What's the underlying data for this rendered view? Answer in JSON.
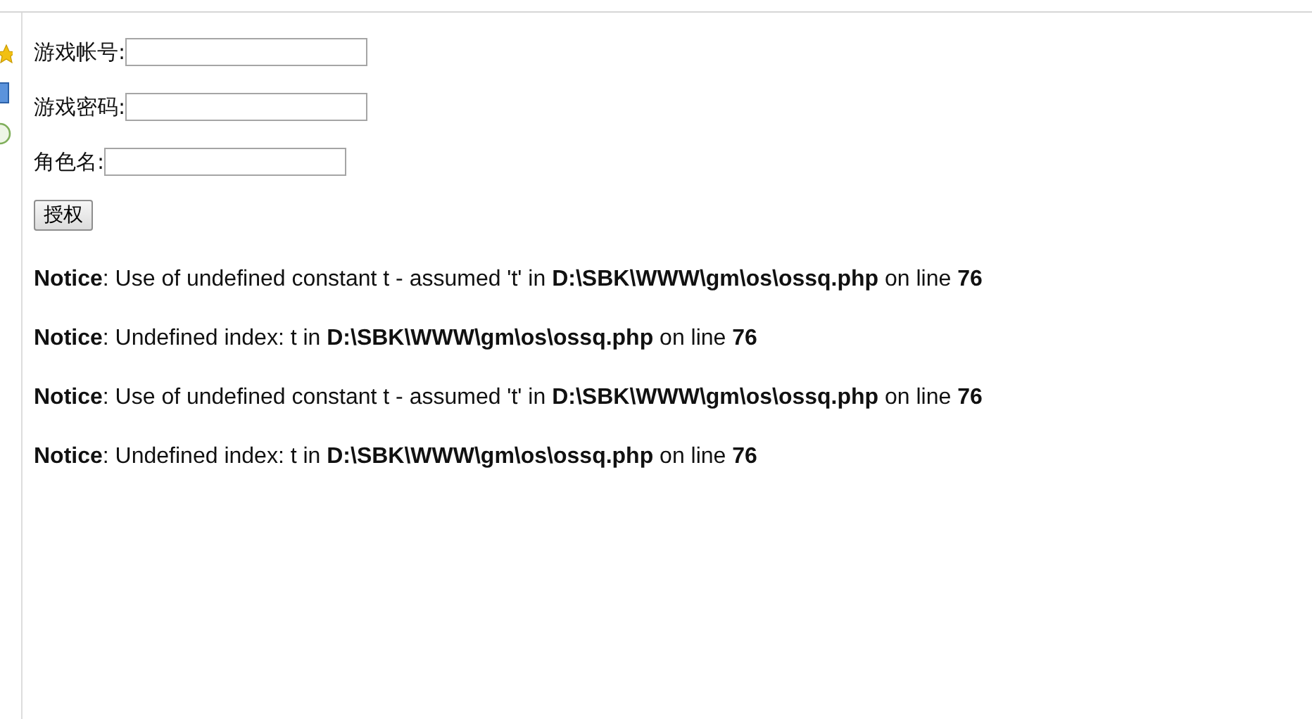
{
  "form": {
    "fields": [
      {
        "label": "游戏帐号:"
      },
      {
        "label": "游戏密码:"
      },
      {
        "label": "角色名:"
      }
    ],
    "submit": "授权"
  },
  "notices": [
    "**Notice**: Use of undefined constant t - assumed 't' in **D:\\SBK\\WWW\\gm\\os\\ossq.php** on line **76**",
    "**Notice**: Undefined index: t in **D:\\SBK\\WWW\\gm\\os\\ossq.php** on line **76**",
    "**Notice**: Use of undefined constant t - assumed 't' in **D:\\SBK\\WWW\\gm\\os\\ossq.php** on line **76**",
    "**Notice**: Undefined index: t in **D:\\SBK\\WWW\\gm\\os\\ossq.php** on line **76**"
  ]
}
